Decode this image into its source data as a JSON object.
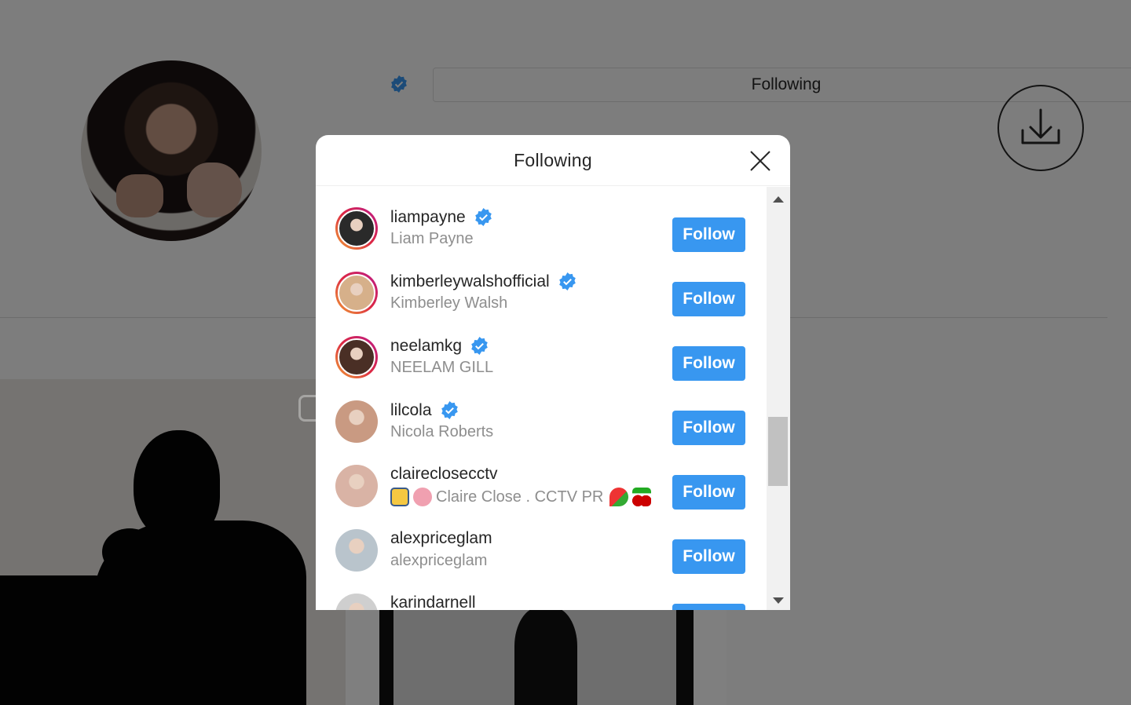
{
  "background": {
    "following_button_label": "Following"
  },
  "modal": {
    "title": "Following",
    "follow_label": "Follow",
    "accounts": [
      {
        "username": "liampayne",
        "full_name": "Liam Payne",
        "verified": true,
        "story_ring": true,
        "avatar_color": "#2a2a2a"
      },
      {
        "username": "kimberleywalshofficial",
        "full_name": "Kimberley Walsh",
        "verified": true,
        "story_ring": true,
        "avatar_color": "#d6b08a"
      },
      {
        "username": "neelamkg",
        "full_name": "NEELAM GILL",
        "verified": true,
        "story_ring": true,
        "avatar_color": "#4a2f25"
      },
      {
        "username": "lilcola",
        "full_name": "Nicola Roberts",
        "verified": true,
        "story_ring": false,
        "avatar_color": "#c99a82"
      },
      {
        "username": "claireclosecctv",
        "full_name": "Claire Close . CCTV PR",
        "verified": false,
        "story_ring": false,
        "avatar_color": "#d9b3a5"
      },
      {
        "username": "alexpriceglam",
        "full_name": "alexpriceglam",
        "verified": false,
        "story_ring": false,
        "avatar_color": "#b9c4cc"
      },
      {
        "username": "karindarnell",
        "full_name": "",
        "verified": false,
        "story_ring": false,
        "avatar_color": "#cfcfcf"
      }
    ]
  },
  "colors": {
    "follow_blue": "#3897f0",
    "verified_blue": "#3897f0",
    "overlay": "rgba(0,0,0,0.5)"
  },
  "icons": [
    "verified-icon",
    "close-icon",
    "download-icon",
    "scroll-up-arrow-icon",
    "scroll-down-arrow-icon"
  ]
}
